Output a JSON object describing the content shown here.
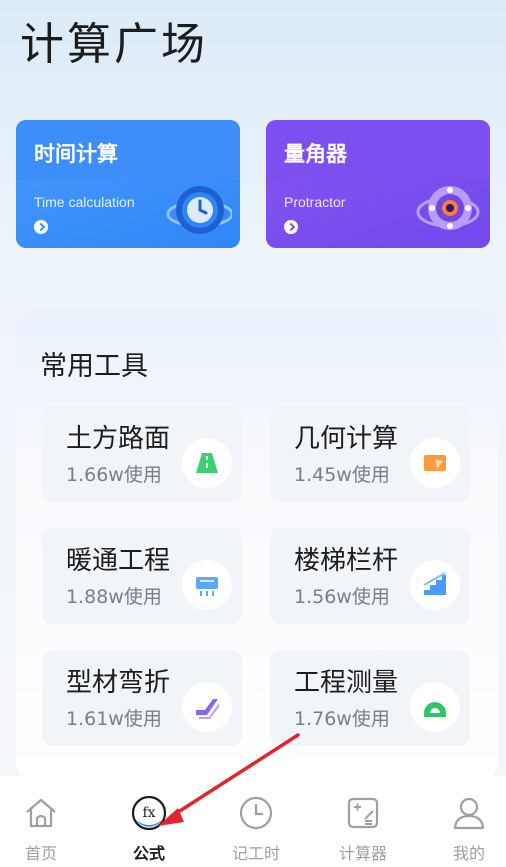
{
  "page": {
    "title": "计算广场"
  },
  "promos": [
    {
      "title": "时间计算",
      "subtitle": "Time calculation",
      "icon": "clock-icon"
    },
    {
      "title": "量角器",
      "subtitle": "Protractor",
      "icon": "protractor-icon"
    }
  ],
  "tools": {
    "title": "常用工具",
    "items": [
      {
        "name": "土方路面",
        "usage": "1.66w使用",
        "icon": "road-icon"
      },
      {
        "name": "几何计算",
        "usage": "1.45w使用",
        "icon": "geometry-icon"
      },
      {
        "name": "暖通工程",
        "usage": "1.88w使用",
        "icon": "air-conditioner-icon"
      },
      {
        "name": "楼梯栏杆",
        "usage": "1.56w使用",
        "icon": "stairs-icon"
      },
      {
        "name": "型材弯折",
        "usage": "1.61w使用",
        "icon": "profile-bend-icon"
      },
      {
        "name": "工程测量",
        "usage": "1.76w使用",
        "icon": "protractor-measure-icon"
      }
    ]
  },
  "tabbar": {
    "active": "公式",
    "items": [
      {
        "label": "首页",
        "icon": "home-icon"
      },
      {
        "label": "公式",
        "icon": "formula-fx-icon"
      },
      {
        "label": "记工时",
        "icon": "clock-icon"
      },
      {
        "label": "计算器",
        "icon": "calculator-icon"
      },
      {
        "label": "我的",
        "icon": "user-icon"
      }
    ]
  },
  "colors": {
    "time_card": "#3d8ef8",
    "protractor_card": "#7e4ff0",
    "annotation_arrow": "#e0262b"
  }
}
